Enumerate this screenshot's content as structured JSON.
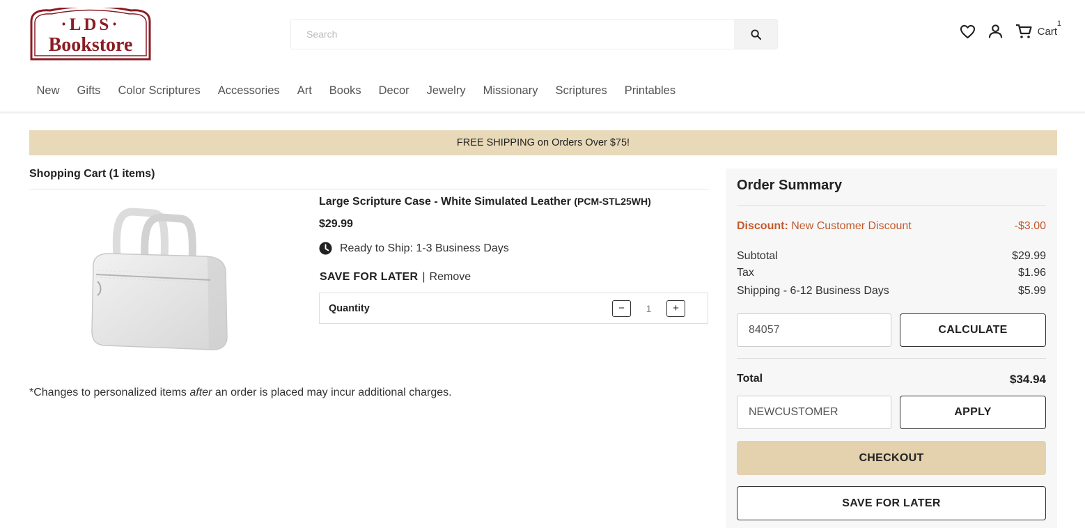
{
  "brand": {
    "logo_top": "·LDS·",
    "logo_bottom": "Bookstore",
    "color": "#8b1c24"
  },
  "search": {
    "placeholder": "Search",
    "icon": "search-icon"
  },
  "header": {
    "cart_label": "Cart",
    "cart_count": "1",
    "icons": [
      "heart-icon",
      "user-icon",
      "cart-icon"
    ]
  },
  "nav": {
    "items": [
      "New",
      "Gifts",
      "Color Scriptures",
      "Accessories",
      "Art",
      "Books",
      "Decor",
      "Jewelry",
      "Missionary",
      "Scriptures",
      "Printables"
    ]
  },
  "banner": {
    "text": "FREE SHIPPING on Orders Over $75!",
    "color": "#e8d9b9"
  },
  "cart": {
    "title": "Shopping Cart (1 items)",
    "item": {
      "name": "Large Scripture Case - White Simulated Leather",
      "sku": "(PCM-STL25WH)",
      "price": "$29.99",
      "ship_text": "Ready to Ship: 1-3 Business Days",
      "save_label": "SAVE FOR LATER",
      "separator": "|",
      "remove_label": "Remove",
      "qty_label": "Quantity",
      "qty_minus": "−",
      "qty_value": "1",
      "qty_plus": "+"
    },
    "note_pre": "*Changes to personalized items ",
    "note_em": "after",
    "note_post": " an order is placed may incur additional charges."
  },
  "summary": {
    "title": "Order Summary",
    "discount_label": "Discount:",
    "discount_name": "New Customer Discount",
    "discount_value": "-$3.00",
    "subtotal_label": "Subtotal",
    "subtotal_value": "$29.99",
    "tax_label": "Tax",
    "tax_value": "$1.96",
    "shipping_label": "Shipping - 6-12 Business Days",
    "shipping_value": "$5.99",
    "zip_value": "84057",
    "calculate_label": "CALCULATE",
    "total_label": "Total",
    "total_value": "$34.94",
    "coupon_value": "NEWCUSTOMER",
    "apply_label": "APPLY",
    "checkout_label": "CHECKOUT",
    "save_label": "SAVE FOR LATER",
    "accent_color": "#c4592c",
    "checkout_color": "#e4d1ad"
  }
}
